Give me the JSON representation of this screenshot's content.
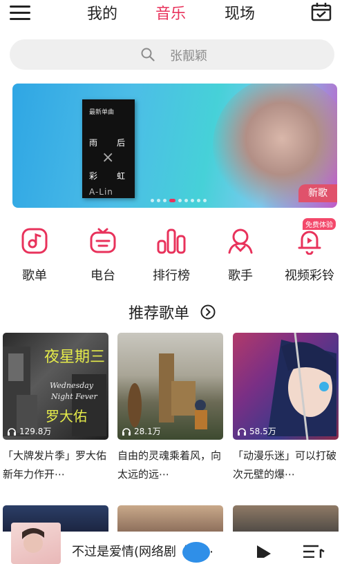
{
  "nav": {
    "tabs": [
      "我的",
      "音乐",
      "现场"
    ],
    "active_tab": "音乐"
  },
  "search": {
    "placeholder": "张靓颖"
  },
  "banner": {
    "album_lines": [
      "最新单曲",
      "雨",
      "后",
      "彩",
      "虹"
    ],
    "artist": "A-Lin",
    "badge": "新歌",
    "dot_count": 9,
    "active_dot": 3
  },
  "categories": [
    {
      "label": "歌单",
      "icon": "playlist-icon"
    },
    {
      "label": "电台",
      "icon": "radio-icon"
    },
    {
      "label": "排行榜",
      "icon": "chart-icon"
    },
    {
      "label": "歌手",
      "icon": "singer-icon"
    },
    {
      "label": "视频彩铃",
      "icon": "ringtone-icon"
    }
  ],
  "free_badge": "免费体验",
  "section": {
    "title": "推荐歌单"
  },
  "playlists": [
    {
      "count": "129.8万",
      "desc": "「大牌发片季」罗大佑新年力作开⋯",
      "cover_text": "夜星期三"
    },
    {
      "count": "28.1万",
      "desc": "自由的灵魂乘着风，向太远的远⋯"
    },
    {
      "count": "58.5万",
      "desc": "「动漫乐迷」可以打破次元壁的爆⋯"
    }
  ],
  "player": {
    "title": "不过是爱情(网络剧《独⋯"
  },
  "colors": {
    "accent": "#e8325b",
    "search_bg": "#efefef"
  }
}
